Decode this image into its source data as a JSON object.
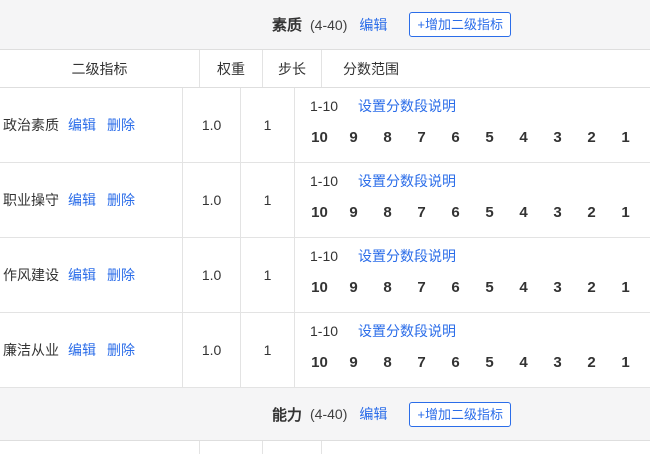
{
  "colors": {
    "accent_blue": "#2b6de9",
    "text_dark": "#333333",
    "band_background": "#f5f5f6",
    "border": "#e3e3e3"
  },
  "sections": [
    {
      "title": "素质",
      "range": "(4-40)",
      "edit_label": "编辑",
      "add_button_label": "+增加二级指标"
    },
    {
      "title": "能力",
      "range": "(4-40)",
      "edit_label": "编辑",
      "add_button_label": "+增加二级指标"
    }
  ],
  "table": {
    "headers": [
      "二级指标",
      "权重",
      "步长",
      "分数范围"
    ],
    "rows": [
      {
        "name": "政治素质",
        "edit": "编辑",
        "delete": "删除",
        "weight": "1.0",
        "step": "1",
        "score_range": "1-10",
        "score_link": "设置分数段说明",
        "scores": [
          "10",
          "9",
          "8",
          "7",
          "6",
          "5",
          "4",
          "3",
          "2",
          "1"
        ]
      },
      {
        "name": "职业操守",
        "edit": "编辑",
        "delete": "删除",
        "weight": "1.0",
        "step": "1",
        "score_range": "1-10",
        "score_link": "设置分数段说明",
        "scores": [
          "10",
          "9",
          "8",
          "7",
          "6",
          "5",
          "4",
          "3",
          "2",
          "1"
        ]
      },
      {
        "name": "作风建设",
        "edit": "编辑",
        "delete": "删除",
        "weight": "1.0",
        "step": "1",
        "score_range": "1-10",
        "score_link": "设置分数段说明",
        "scores": [
          "10",
          "9",
          "8",
          "7",
          "6",
          "5",
          "4",
          "3",
          "2",
          "1"
        ]
      },
      {
        "name": "廉洁从业",
        "edit": "编辑",
        "delete": "删除",
        "weight": "1.0",
        "step": "1",
        "score_range": "1-10",
        "score_link": "设置分数段说明",
        "scores": [
          "10",
          "9",
          "8",
          "7",
          "6",
          "5",
          "4",
          "3",
          "2",
          "1"
        ]
      }
    ]
  }
}
